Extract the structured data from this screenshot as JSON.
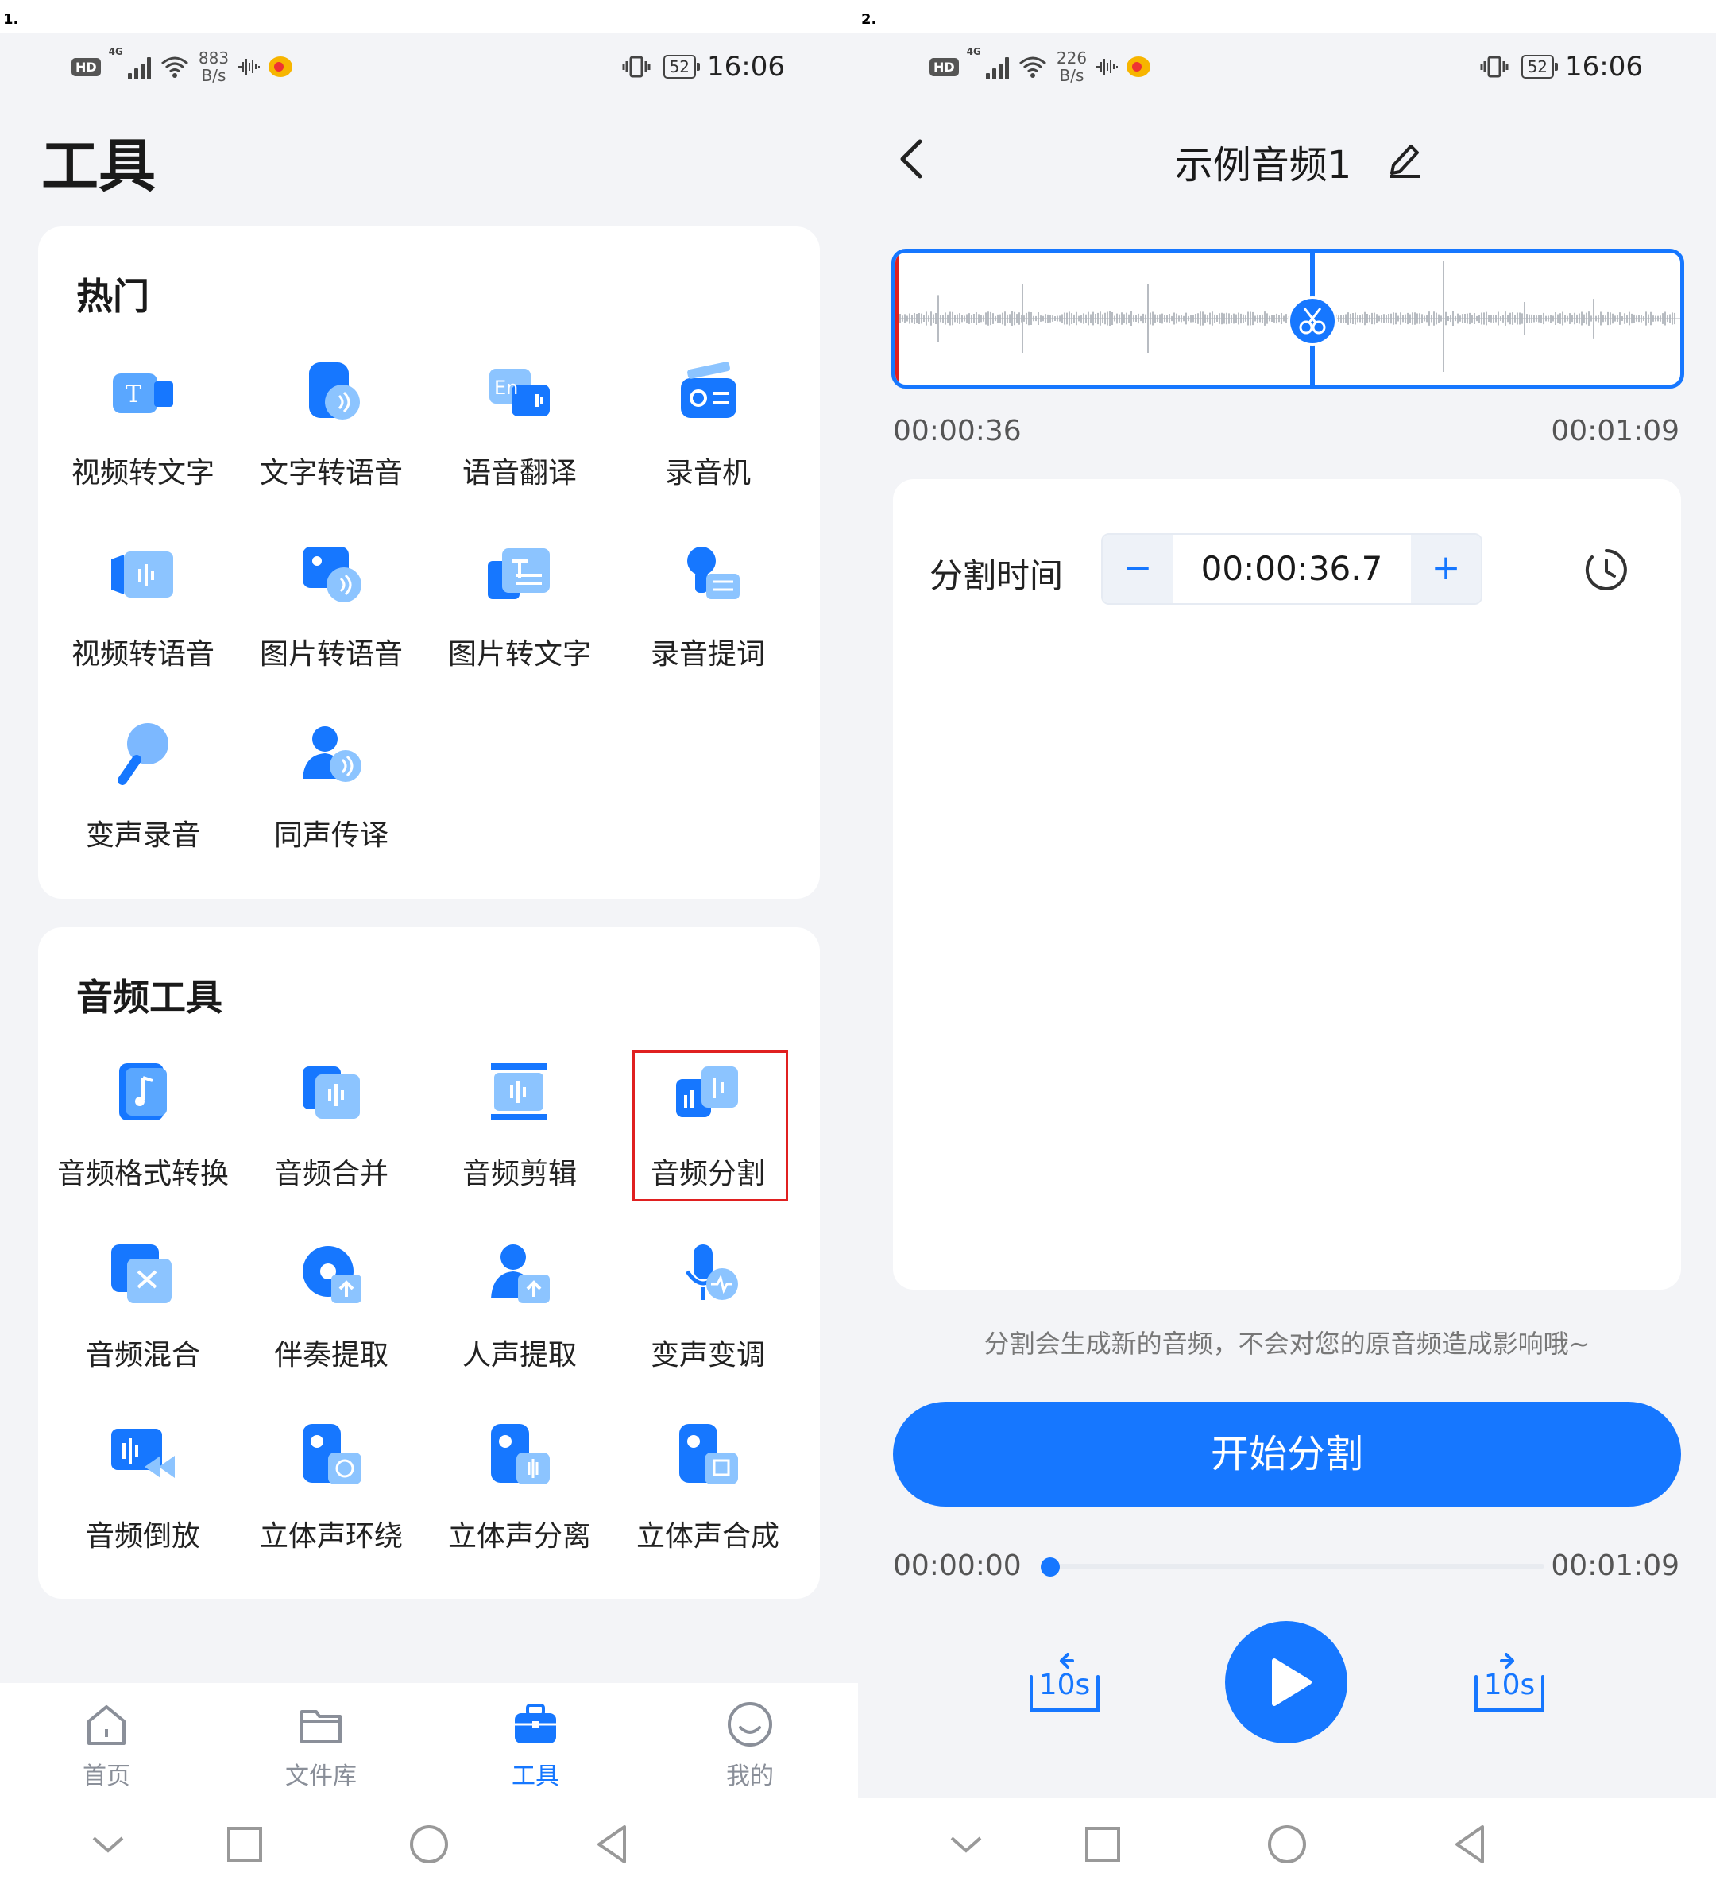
{
  "labels": {
    "left": "1.",
    "right": "2."
  },
  "colors": {
    "accent": "#1677ff",
    "highlight": "#e02020",
    "page_bg": "#f3f4f7"
  },
  "status_left": {
    "speed_value": "883",
    "speed_unit": "B/s",
    "battery": "52",
    "time": "16:06",
    "network": "4G"
  },
  "status_right": {
    "speed_value": "226",
    "speed_unit": "B/s",
    "battery": "52",
    "time": "16:06",
    "network": "4G"
  },
  "tools_page": {
    "title": "工具",
    "hot": {
      "heading": "热门",
      "items": [
        {
          "label": "视频转文字",
          "icon": "video-to-text-icon"
        },
        {
          "label": "文字转语音",
          "icon": "text-to-speech-icon"
        },
        {
          "label": "语音翻译",
          "icon": "voice-translate-icon"
        },
        {
          "label": "录音机",
          "icon": "recorder-icon"
        },
        {
          "label": "视频转语音",
          "icon": "video-to-audio-icon"
        },
        {
          "label": "图片转语音",
          "icon": "image-to-speech-icon"
        },
        {
          "label": "图片转文字",
          "icon": "image-to-text-icon"
        },
        {
          "label": "录音提词",
          "icon": "teleprompter-icon"
        },
        {
          "label": "变声录音",
          "icon": "voice-change-mic-icon"
        },
        {
          "label": "同声传译",
          "icon": "simultaneous-interpret-icon"
        }
      ]
    },
    "audio": {
      "heading": "音频工具",
      "items": [
        {
          "label": "音频格式转换",
          "icon": "audio-format-icon"
        },
        {
          "label": "音频合并",
          "icon": "audio-merge-icon"
        },
        {
          "label": "音频剪辑",
          "icon": "audio-clip-icon"
        },
        {
          "label": "音频分割",
          "icon": "audio-split-icon"
        },
        {
          "label": "音频混合",
          "icon": "audio-mix-icon"
        },
        {
          "label": "伴奏提取",
          "icon": "accompaniment-extract-icon"
        },
        {
          "label": "人声提取",
          "icon": "vocal-extract-icon"
        },
        {
          "label": "变声变调",
          "icon": "pitch-change-icon"
        },
        {
          "label": "音频倒放",
          "icon": "audio-reverse-icon"
        },
        {
          "label": "立体声环绕",
          "icon": "stereo-surround-icon"
        },
        {
          "label": "立体声分离",
          "icon": "stereo-separate-icon"
        },
        {
          "label": "立体声合成",
          "icon": "stereo-compose-icon"
        }
      ]
    },
    "tabs": [
      {
        "label": "首页",
        "icon": "home-icon"
      },
      {
        "label": "文件库",
        "icon": "folder-icon"
      },
      {
        "label": "工具",
        "icon": "toolbox-icon",
        "active": true
      },
      {
        "label": "我的",
        "icon": "profile-smile-icon"
      }
    ]
  },
  "split_page": {
    "title": "示例音频1",
    "wave_start": "00:00:36",
    "wave_end": "00:01:09",
    "split_label": "分割时间",
    "split_value": "00:00:36.7",
    "minus": "−",
    "plus": "+",
    "hint": "分割会生成新的音频，不会对您的原音频造成影响哦~",
    "start_button": "开始分割",
    "progress_current": "00:00:00",
    "progress_total": "00:01:09",
    "progress_fraction": 0,
    "skip_back": "10s",
    "skip_forward": "10s"
  }
}
